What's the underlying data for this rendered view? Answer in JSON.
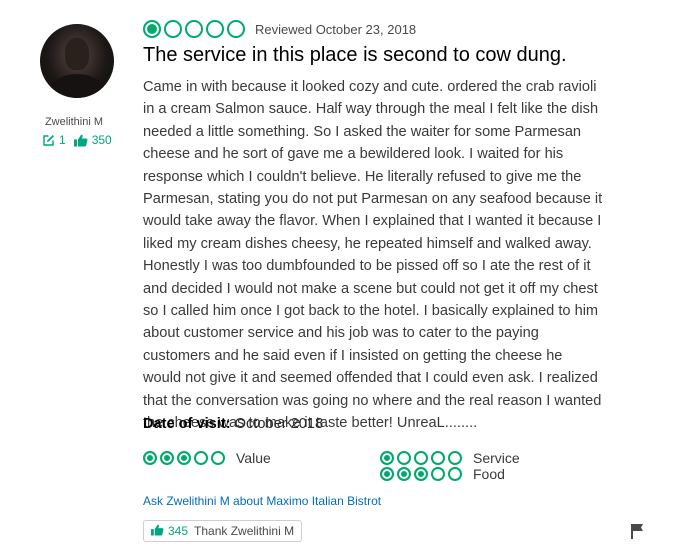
{
  "reviewer": {
    "name": "Zwelithini M",
    "contributions": "1",
    "helpful_votes": "350"
  },
  "review": {
    "rating": 1,
    "max_rating": 5,
    "date_text": "Reviewed October 23, 2018",
    "title": "The service in this place is second to cow dung.",
    "body": "Came in with because it looked cozy and cute. ordered the crab ravioli in a cream Salmon sauce. Half way through the meal I felt like the dish needed a little something. So I asked the waiter for some Parmesan cheese and he sort of gave me a bewildered look. I waited for his response which I couldn't believe. He literally refused to give me the Parmesan, stating you do not put Parmesan on any seafood because it would take away the flavor. When I explained that I wanted it because I liked my cream dishes cheesy, he repeated himself and walked away. Honestly I was too dumbfounded to be pissed off so I ate the rest of it and decided I would not make a scene but could not get it off my chest so I called him once I got back to the hotel. I basically explained to him about customer service and his job was to cater to the paying customers and he said even if I insisted on getting the cheese he would not give it and seemed offended that I could even ask. I realized that the conversation was going no where and the real reason I wanted the cheese was to make it taste better! UnreaL........",
    "date_of_visit_label": "Date of visit:",
    "date_of_visit": "October 2018"
  },
  "sub_ratings": {
    "value": {
      "label": "Value",
      "rating": 3
    },
    "service": {
      "label": "Service",
      "rating": 1
    },
    "food": {
      "label": "Food",
      "rating": 3
    }
  },
  "ask_link": "Ask Zwelithini M about Maximo Italian Bistrot",
  "thank_button": {
    "count": "345",
    "label": "Thank Zwelithini M"
  },
  "colors": {
    "bubble_green": "#00aa6c",
    "stat_green": "#00a680",
    "link_blue": "#006dba"
  },
  "icons": [
    "review-count-icon",
    "helpful-vote-icon",
    "thumbs-up-icon",
    "flag-icon"
  ]
}
